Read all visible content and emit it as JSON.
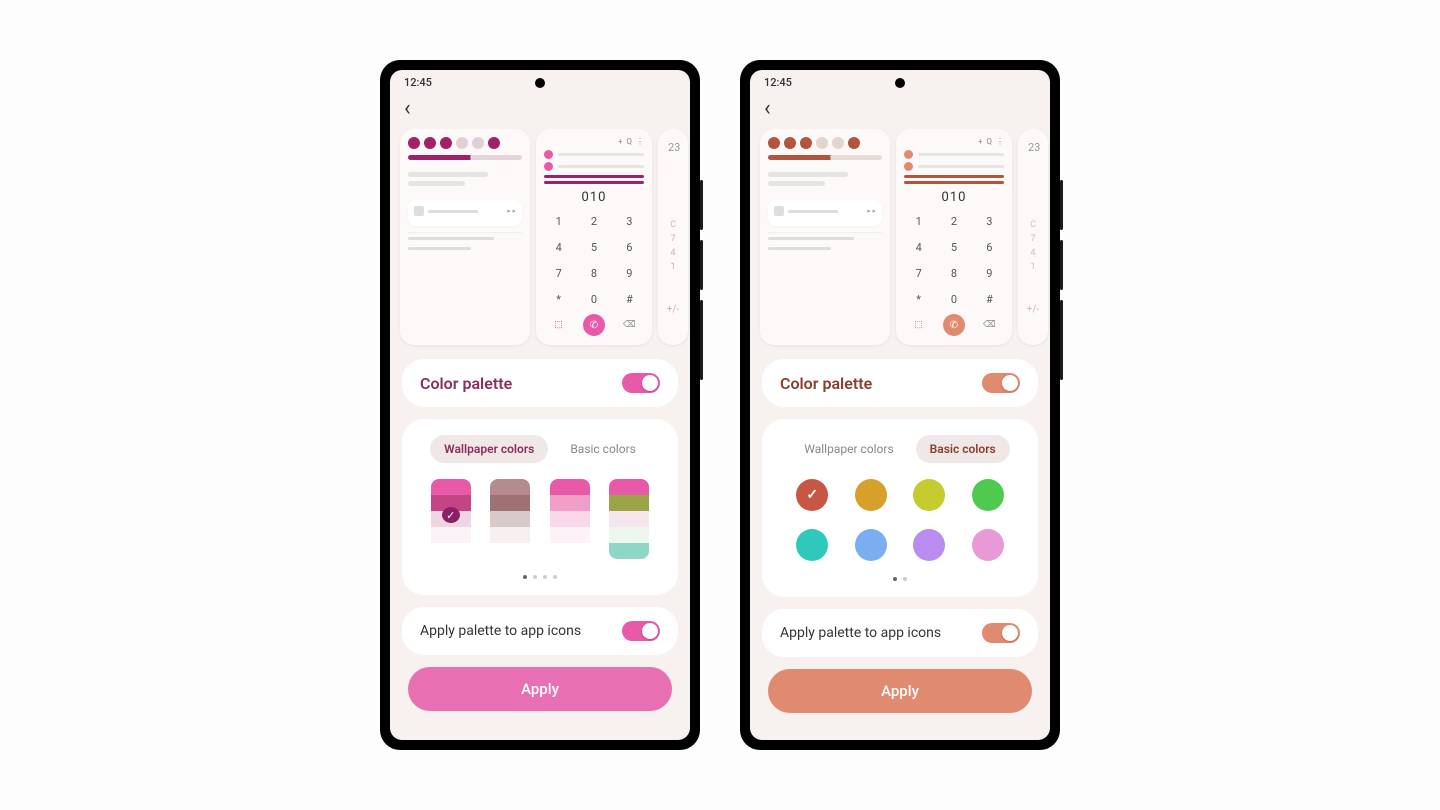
{
  "phones": [
    {
      "accent": "#e859a8",
      "accent_dark": "#a02168",
      "time": "12:45",
      "palette_title": "Color palette",
      "palette_title_color": "#8a2e5c",
      "palette_toggle": true,
      "tabs": {
        "wallpaper": "Wallpaper colors",
        "basic": "Basic colors",
        "active": "wallpaper",
        "active_color": "#8a2e5c"
      },
      "wallpaper_swatches": [
        {
          "colors": [
            "#e85aa8",
            "#c24585",
            "#f0d5e4",
            "#fff",
            "#fff"
          ],
          "selected": true,
          "check_color": "#8a2166"
        },
        {
          "colors": [
            "#b58b8f",
            "#9e7175",
            "#d8c9ca",
            "#f6f0f0",
            "#fff"
          ],
          "selected": false
        },
        {
          "colors": [
            "#e85aa8",
            "#f09fc8",
            "#f9d9e9",
            "#fdf2f7",
            "#fff"
          ],
          "selected": false
        },
        {
          "colors": [
            "#e85aa8",
            "#9aa545",
            "#f4e6ec",
            "#eef7ee",
            "#8ed7c7"
          ],
          "selected": false
        }
      ],
      "pager": {
        "count": 4,
        "active": 0
      },
      "icons_label": "Apply palette to app icons",
      "icons_toggle": true,
      "apply_label": "Apply",
      "dialer_display": "010",
      "clock_peek": "23"
    },
    {
      "accent": "#e08a6f",
      "accent_dark": "#b1553c",
      "time": "12:45",
      "palette_title": "Color palette",
      "palette_title_color": "#8a3e2e",
      "palette_toggle": true,
      "tabs": {
        "wallpaper": "Wallpaper colors",
        "basic": "Basic colors",
        "active": "basic",
        "active_color": "#8a3e2e"
      },
      "basic_colors": [
        {
          "hex": "#c75742",
          "selected": true
        },
        {
          "hex": "#d6a02a"
        },
        {
          "hex": "#c5cc2f"
        },
        {
          "hex": "#4fc94f"
        },
        {
          "hex": "#2ec9bb"
        },
        {
          "hex": "#7aaef0"
        },
        {
          "hex": "#b98df0"
        },
        {
          "hex": "#e89ad6"
        }
      ],
      "pager": {
        "count": 2,
        "active": 0
      },
      "icons_label": "Apply palette to app icons",
      "icons_toggle": true,
      "apply_label": "Apply",
      "dialer_display": "010",
      "clock_peek": "23"
    }
  ],
  "keypad": [
    "1",
    "2",
    "3",
    "4",
    "5",
    "6",
    "7",
    "8",
    "9",
    "*",
    "0",
    "#"
  ]
}
